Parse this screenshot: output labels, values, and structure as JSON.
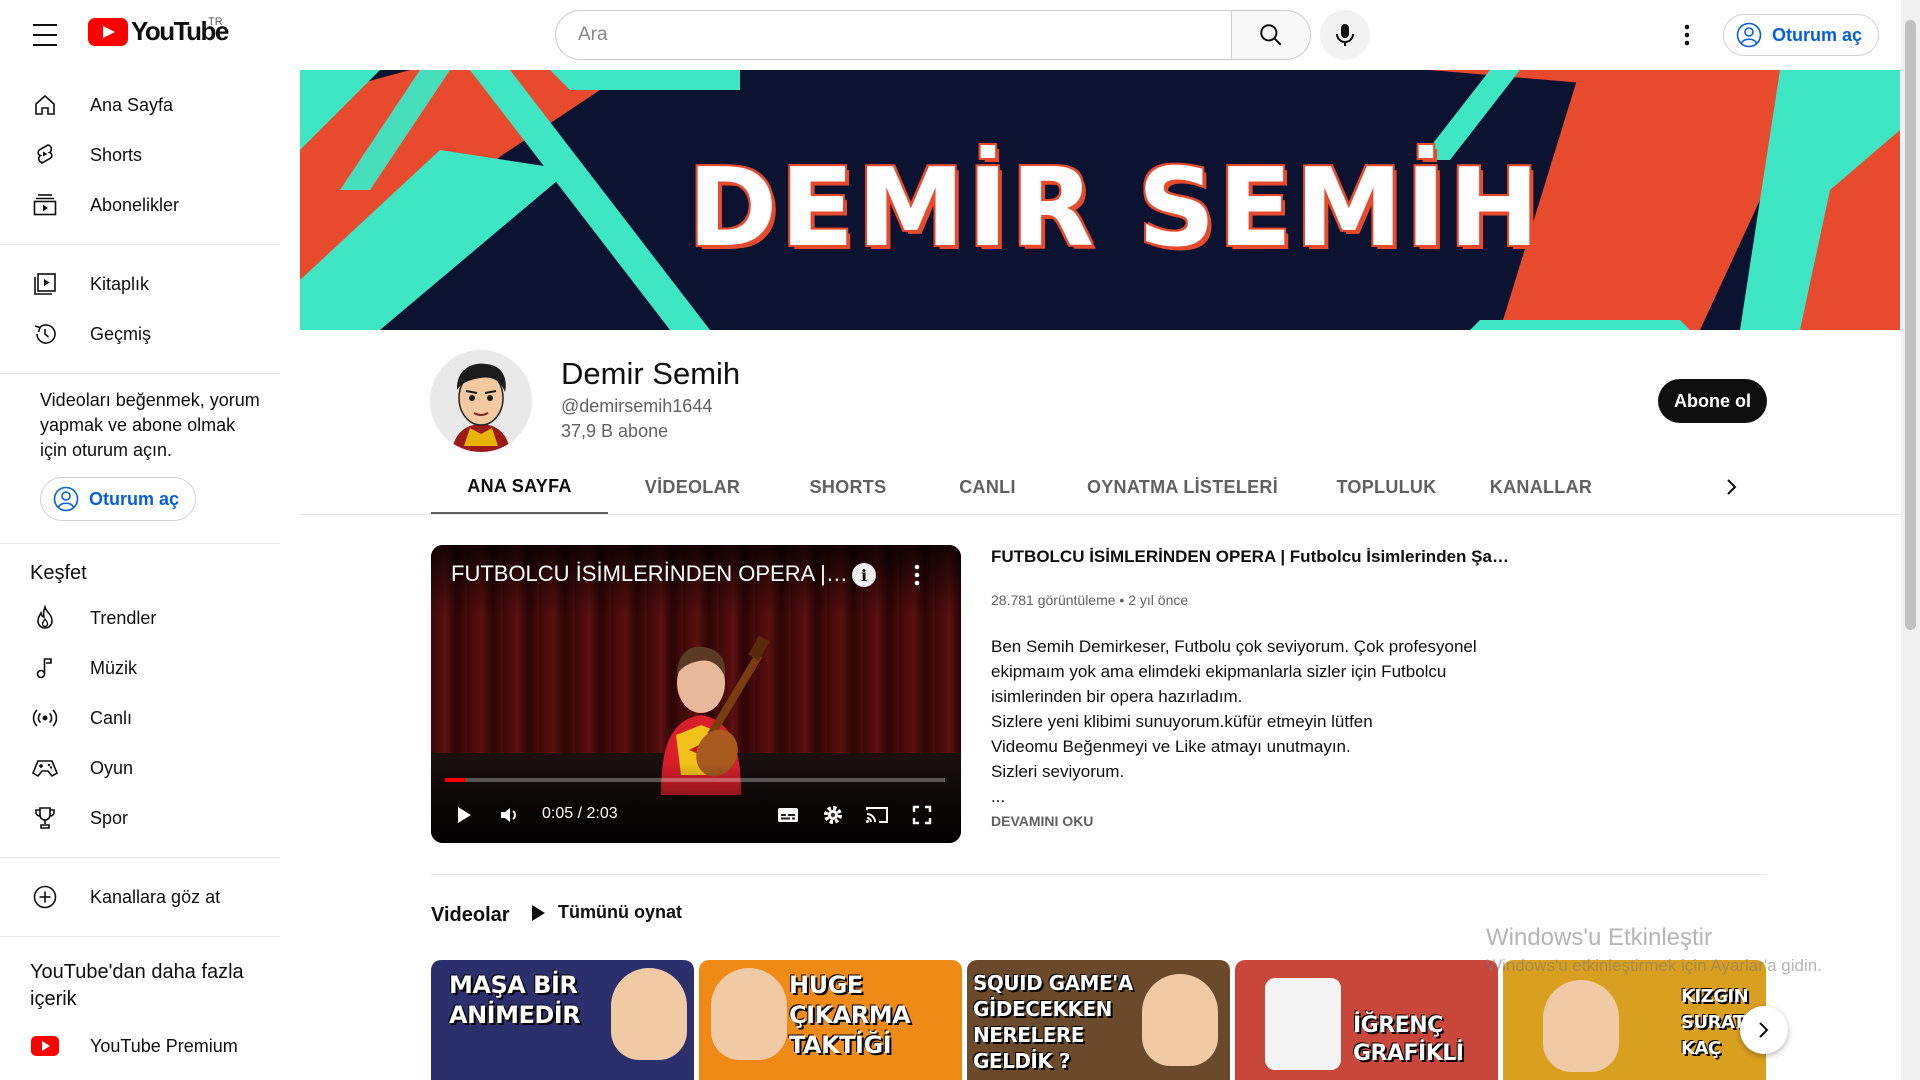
{
  "header": {
    "logo_text": "YouTube",
    "country": "TR",
    "search_placeholder": "Ara",
    "signin_label": "Oturum aç"
  },
  "sidebar": {
    "main": [
      {
        "label": "Ana Sayfa",
        "icon": "home-icon"
      },
      {
        "label": "Shorts",
        "icon": "shorts-icon"
      },
      {
        "label": "Abonelikler",
        "icon": "subscriptions-icon"
      }
    ],
    "library": [
      {
        "label": "Kitaplık",
        "icon": "library-icon"
      },
      {
        "label": "Geçmiş",
        "icon": "history-icon"
      }
    ],
    "signin_prompt": "Videoları beğenmek, yorum yapmak ve abone olmak için oturum açın.",
    "signin_label": "Oturum aç",
    "explore_heading": "Keşfet",
    "explore": [
      {
        "label": "Trendler",
        "icon": "trending-icon"
      },
      {
        "label": "Müzik",
        "icon": "music-icon"
      },
      {
        "label": "Canlı",
        "icon": "live-icon"
      },
      {
        "label": "Oyun",
        "icon": "gaming-icon"
      },
      {
        "label": "Spor",
        "icon": "trophy-icon"
      }
    ],
    "browse_channels": {
      "label": "Kanallara göz at",
      "icon": "add-circle-icon"
    },
    "more_heading": "YouTube'dan daha fazla içerik",
    "premium": {
      "label": "YouTube Premium",
      "icon": "youtube-premium-icon"
    }
  },
  "banner": {
    "title": "DEMİR SEMİH",
    "colors": {
      "background": "#0b1331",
      "orange": "#e84a2e",
      "teal": "#3ee6c4"
    }
  },
  "channel": {
    "name": "Demir Semih",
    "handle": "@demirsemih1644",
    "subscribers": "37,9 B abone",
    "subscribe_label": "Abone ol"
  },
  "tabs": [
    {
      "label": "ANA SAYFA",
      "active": true
    },
    {
      "label": "VİDEOLAR",
      "active": false
    },
    {
      "label": "SHORTS",
      "active": false
    },
    {
      "label": "CANLI",
      "active": false
    },
    {
      "label": "OYNATMA LİSTELERİ",
      "active": false
    },
    {
      "label": "TOPLULUK",
      "active": false
    },
    {
      "label": "KANALLAR",
      "active": false
    }
  ],
  "featured": {
    "player_title": "FUTBOLCU İSİMLERİNDEN OPERA | Futbolcu İsimlerinden Şarkı",
    "time": "0:05 / 2:03",
    "progress": 0.04,
    "title": "FUTBOLCU İSİMLERİNDEN OPERA | Futbolcu İsimlerinden Şarkı",
    "meta": "28.781 görüntüleme • 2 yıl önce",
    "description": [
      "Ben Semih Demirkeser, Futbolu çok seviyorum. Çok profesyonel",
      "ekipmaım yok ama elimdeki ekipmanlarla sizler için Futbolcu",
      "isimlerinden bir opera hazırladım.",
      "Sizlere yeni klibimi sunuyorum.küfür etmeyin lütfen",
      "Videomu Beğenmeyi ve Like atmayı unutmayın.",
      "Sizleri seviyorum.",
      "..."
    ],
    "read_more": "DEVAMINI OKU"
  },
  "shelf": {
    "title": "Videolar",
    "play_all": "Tümünü oynat",
    "thumbnails": [
      {
        "text": "MAŞA BİR\nANİMEDİR",
        "bg": "#2b2f6b"
      },
      {
        "text": "HUGE ÇIKARMA\nTAKTİĞİ",
        "bg": "#f08a16"
      },
      {
        "text": "SQUID GAME'A\nGİDECEKKEN\nNERELERE\nGELDİK ?",
        "bg": "#6a4a2a"
      },
      {
        "text": "İĞRENÇ\nGRAFİKLİ",
        "bg": "#c9463a"
      },
      {
        "text": "KIZGIN\nSURATDA\nKAÇ",
        "bg": "#d9a020"
      }
    ]
  },
  "watermark": {
    "line1": "Windows'u Etkinleştir",
    "line2": "Windows'u etkinleştirmek için Ayarlar'a gidin."
  }
}
